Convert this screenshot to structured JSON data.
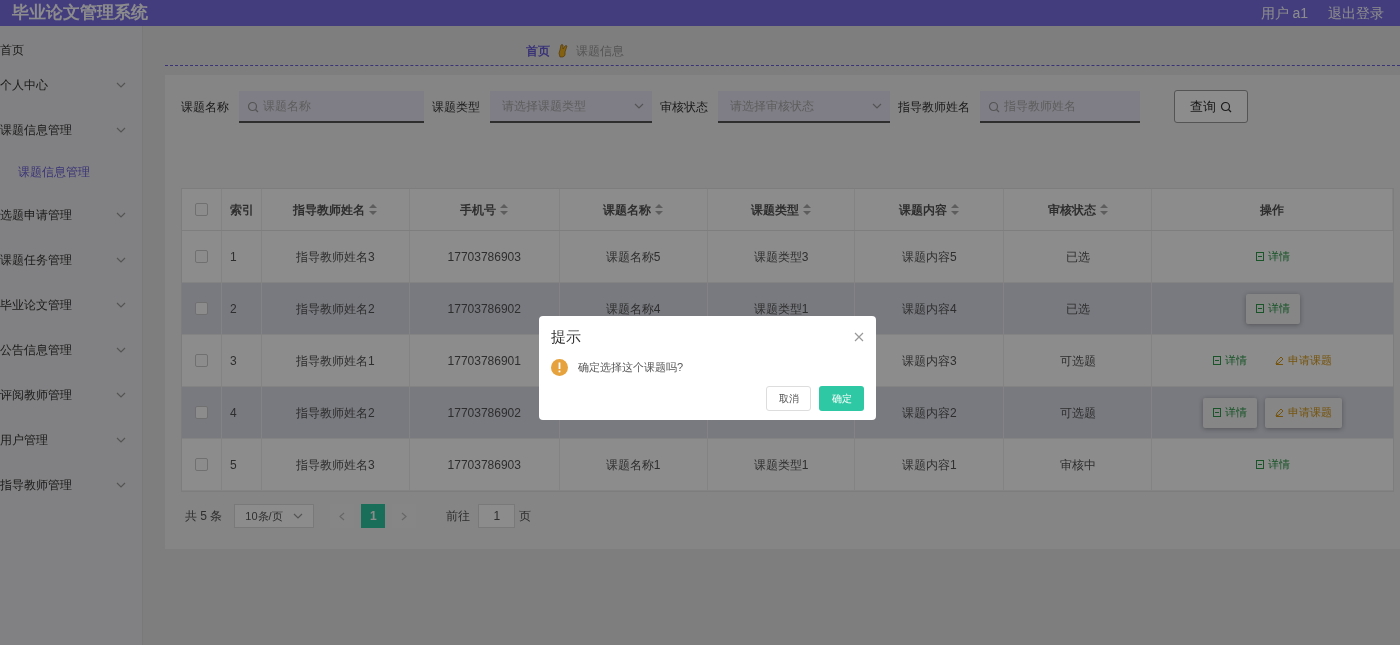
{
  "header": {
    "title": "毕业论文管理系统",
    "user": "用户 a1",
    "logout": "退出登录"
  },
  "sidebar": {
    "items": [
      {
        "label": "首页",
        "expandable": false,
        "selected": false
      },
      {
        "label": "个人中心",
        "expandable": true,
        "selected": false
      },
      {
        "label": "课题信息管理",
        "expandable": true,
        "selected": false,
        "children": [
          {
            "label": "课题信息管理",
            "selected": true
          }
        ]
      },
      {
        "label": "选题申请管理",
        "expandable": true,
        "selected": false
      },
      {
        "label": "课题任务管理",
        "expandable": true,
        "selected": false
      },
      {
        "label": "毕业论文管理",
        "expandable": true,
        "selected": false
      },
      {
        "label": "公告信息管理",
        "expandable": true,
        "selected": false
      },
      {
        "label": "评阅教师管理",
        "expandable": true,
        "selected": false
      },
      {
        "label": "用户管理",
        "expandable": true,
        "selected": false
      },
      {
        "label": "指导教师管理",
        "expandable": true,
        "selected": false
      }
    ]
  },
  "breadcrumb": [
    "首页",
    "课题信息"
  ],
  "filters": [
    {
      "kind": "text",
      "label": "课题名称",
      "placeholder": "课题名称"
    },
    {
      "kind": "select",
      "label": "课题类型",
      "placeholder": "请选择课题类型"
    },
    {
      "kind": "select",
      "label": "审核状态",
      "placeholder": "请选择审核状态"
    },
    {
      "kind": "text",
      "label": "指导教师姓名",
      "placeholder": "指导教师姓名"
    }
  ],
  "search_button": "查询",
  "table": {
    "all_checked": false,
    "columns": [
      {
        "label": "索引",
        "sortable": false
      },
      {
        "label": "指导教师姓名",
        "sortable": true
      },
      {
        "label": "手机号",
        "sortable": true
      },
      {
        "label": "课题名称",
        "sortable": true
      },
      {
        "label": "课题类型",
        "sortable": true
      },
      {
        "label": "课题内容",
        "sortable": true
      },
      {
        "label": "审核状态",
        "sortable": true
      },
      {
        "label": "操作",
        "sortable": false
      }
    ],
    "rows": [
      {
        "highlighted": false,
        "checked": false,
        "cells": [
          "1",
          "指导教师姓名3",
          "17703786903",
          "课题名称5",
          "课题类型3",
          "课题内容5",
          "已选"
        ],
        "actions": [
          {
            "kind": "detail",
            "label": "详情",
            "hovered": false
          }
        ]
      },
      {
        "highlighted": true,
        "checked": false,
        "cells": [
          "2",
          "指导教师姓名2",
          "17703786902",
          "课题名称4",
          "课题类型1",
          "课题内容4",
          "已选"
        ],
        "actions": [
          {
            "kind": "detail",
            "label": "详情",
            "hovered": true
          }
        ]
      },
      {
        "highlighted": false,
        "checked": false,
        "cells": [
          "3",
          "指导教师姓名1",
          "17703786901",
          null,
          null,
          "课题内容3",
          "可选题"
        ],
        "actions": [
          {
            "kind": "detail",
            "label": "详情",
            "hovered": false
          },
          {
            "kind": "apply",
            "label": "申请课题",
            "hovered": false
          }
        ]
      },
      {
        "highlighted": true,
        "checked": false,
        "cells": [
          "4",
          "指导教师姓名2",
          "17703786902",
          null,
          null,
          "课题内容2",
          "可选题"
        ],
        "actions": [
          {
            "kind": "detail",
            "label": "详情",
            "hovered": true
          },
          {
            "kind": "apply",
            "label": "申请课题",
            "hovered": true
          }
        ]
      },
      {
        "highlighted": false,
        "checked": false,
        "cells": [
          "5",
          "指导教师姓名3",
          "17703786903",
          "课题名称1",
          "课题类型1",
          "课题内容1",
          "审核中"
        ],
        "actions": [
          {
            "kind": "detail",
            "label": "详情",
            "hovered": false
          }
        ]
      }
    ]
  },
  "pagination": {
    "total": "共 5 条",
    "page_size": "10条/页",
    "pages": [
      {
        "label": "1",
        "selected": true
      }
    ],
    "goto_label": "前往",
    "goto_value": "1",
    "goto_suffix": "页"
  },
  "dialog": {
    "title": "提示",
    "message": "确定选择这个课题吗?",
    "cancel": "取消",
    "confirm": "确定"
  }
}
